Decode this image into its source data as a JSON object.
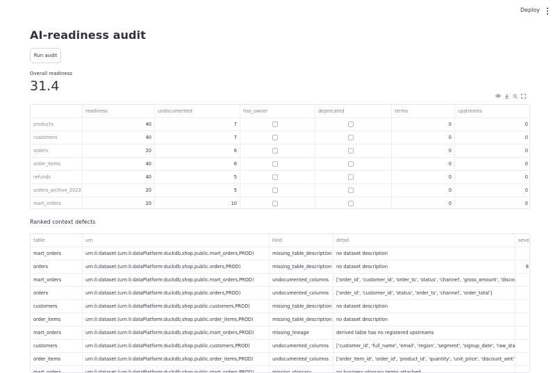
{
  "header": {
    "deploy_label": "Deploy",
    "menu_icon": "vertical-dots-icon"
  },
  "title": "AI-readiness audit",
  "run_button_label": "Run audit",
  "metric": {
    "label": "Overall readiness",
    "value": "31.4"
  },
  "toolbar_icons": [
    "eye-icon",
    "download-icon",
    "search-icon",
    "fullscreen-icon"
  ],
  "readiness_table": {
    "columns": [
      "",
      "readiness",
      "undocumented",
      "has_owner",
      "deprecated",
      "terms",
      "upstreams"
    ],
    "rows": [
      {
        "name": "products",
        "readiness": "40",
        "undocumented": "7",
        "has_owner": false,
        "deprecated": false,
        "terms": "0",
        "upstreams": "0"
      },
      {
        "name": "customers",
        "readiness": "40",
        "undocumented": "7",
        "has_owner": false,
        "deprecated": false,
        "terms": "0",
        "upstreams": "0"
      },
      {
        "name": "orders",
        "readiness": "20",
        "undocumented": "6",
        "has_owner": false,
        "deprecated": false,
        "terms": "0",
        "upstreams": "0"
      },
      {
        "name": "order_items",
        "readiness": "40",
        "undocumented": "6",
        "has_owner": false,
        "deprecated": false,
        "terms": "0",
        "upstreams": "0"
      },
      {
        "name": "refunds",
        "readiness": "40",
        "undocumented": "5",
        "has_owner": false,
        "deprecated": false,
        "terms": "0",
        "upstreams": "0"
      },
      {
        "name": "orders_archive_2023",
        "readiness": "20",
        "undocumented": "5",
        "has_owner": false,
        "deprecated": false,
        "terms": "0",
        "upstreams": "0"
      },
      {
        "name": "mart_orders",
        "readiness": "20",
        "undocumented": "10",
        "has_owner": false,
        "deprecated": false,
        "terms": "0",
        "upstreams": "0"
      }
    ]
  },
  "defects_heading": "Ranked context defects",
  "defects_table": {
    "columns": [
      "table",
      "urn",
      "kind",
      "detail",
      "sever"
    ],
    "rows": [
      {
        "table": "mart_orders",
        "urn": "urn:li:dataset:(urn:li:dataPlatform:duckdb,shop.public.mart_orders,PROD)",
        "kind": "missing_table_description",
        "detail": "no dataset description",
        "severity": ""
      },
      {
        "table": "orders",
        "urn": "urn:li:dataset:(urn:li:dataPlatform:duckdb,shop.public.orders,PROD)",
        "kind": "missing_table_description",
        "detail": "no dataset description",
        "severity": "8"
      },
      {
        "table": "mart_orders",
        "urn": "urn:li:dataset:(urn:li:dataPlatform:duckdb,shop.public.mart_orders,PROD)",
        "kind": "undocumented_columns",
        "detail": "['order_id', 'customer_id', 'order_ts', 'status', 'channel', 'gross_amount', 'discount_am",
        "severity": ""
      },
      {
        "table": "orders",
        "urn": "urn:li:dataset:(urn:li:dataPlatform:duckdb,shop.public.orders,PROD)",
        "kind": "undocumented_columns",
        "detail": "['order_id', 'customer_id', 'status', 'order_ts', 'channel', 'order_total']",
        "severity": ""
      },
      {
        "table": "customers",
        "urn": "urn:li:dataset:(urn:li:dataPlatform:duckdb,shop.public.customers,PROD)",
        "kind": "missing_table_description",
        "detail": "no dataset description",
        "severity": ""
      },
      {
        "table": "order_items",
        "urn": "urn:li:dataset:(urn:li:dataPlatform:duckdb,shop.public.order_items,PROD)",
        "kind": "missing_table_description",
        "detail": "no dataset description",
        "severity": ""
      },
      {
        "table": "mart_orders",
        "urn": "urn:li:dataset:(urn:li:dataPlatform:duckdb,shop.public.mart_orders,PROD)",
        "kind": "missing_lineage",
        "detail": "derived table has no registered upstreams",
        "severity": ""
      },
      {
        "table": "customers",
        "urn": "urn:li:dataset:(urn:li:dataPlatform:duckdb,shop.public.customers,PROD)",
        "kind": "undocumented_columns",
        "detail": "['customer_id', 'full_name', 'email', 'region', 'segment', 'signup_date', 'raw_status']",
        "severity": ""
      },
      {
        "table": "order_items",
        "urn": "urn:li:dataset:(urn:li:dataPlatform:duckdb,shop.public.order_items,PROD)",
        "kind": "undocumented_columns",
        "detail": "['order_item_id', 'order_id', 'product_id', 'quantity', 'unit_price', 'discount_amt']",
        "severity": ""
      },
      {
        "table": "mart_orders",
        "urn": "urn:li:dataset:(urn:li:dataPlatform:duckdb,shop.public.mart_orders,PROD)",
        "kind": "missing_glossary",
        "detail": "no business glossary terms attached",
        "severity": ""
      }
    ]
  }
}
